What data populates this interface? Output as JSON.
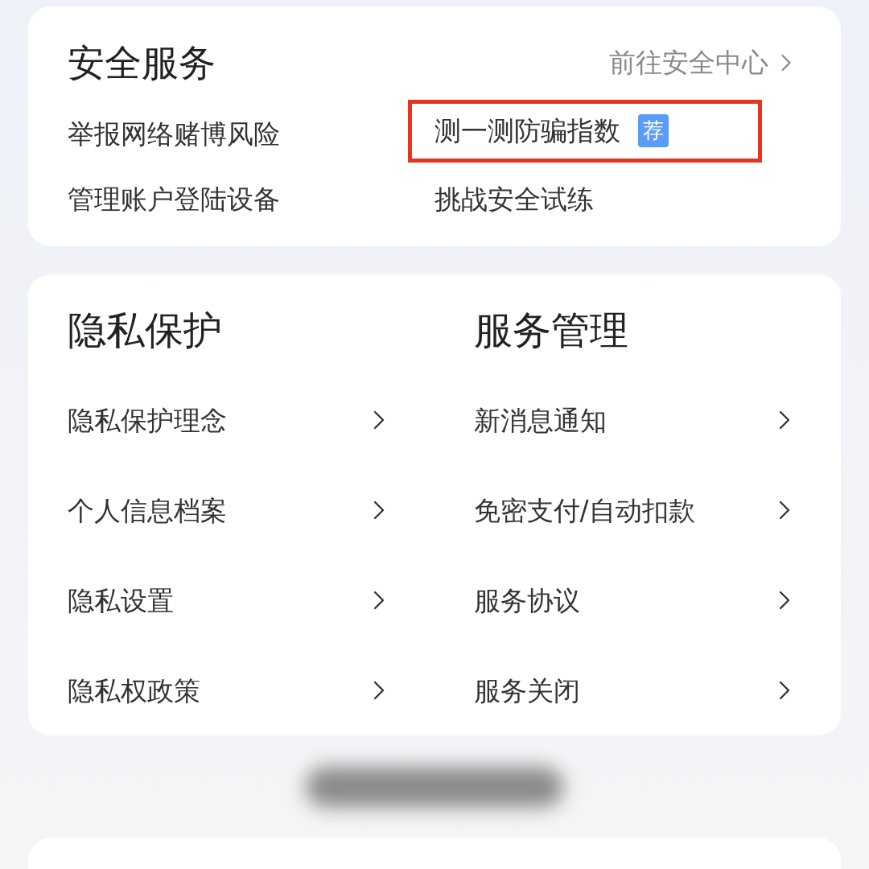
{
  "security_services": {
    "title": "安全服务",
    "link": "前往安全中心",
    "items": [
      {
        "label": "举报网络赌博风险",
        "highlighted": false
      },
      {
        "label": "测一测防骗指数",
        "badge": "荐",
        "highlighted": true
      },
      {
        "label": "管理账户登陆设备",
        "highlighted": false
      },
      {
        "label": "挑战安全试练",
        "highlighted": false
      }
    ]
  },
  "sections": [
    {
      "title": "隐私保护",
      "items": [
        "隐私保护理念",
        "个人信息档案",
        "隐私设置",
        "隐私权政策"
      ]
    },
    {
      "title": "服务管理",
      "items": [
        "新消息通知",
        "免密支付/自动扣款",
        "服务协议",
        "服务关闭"
      ]
    }
  ]
}
